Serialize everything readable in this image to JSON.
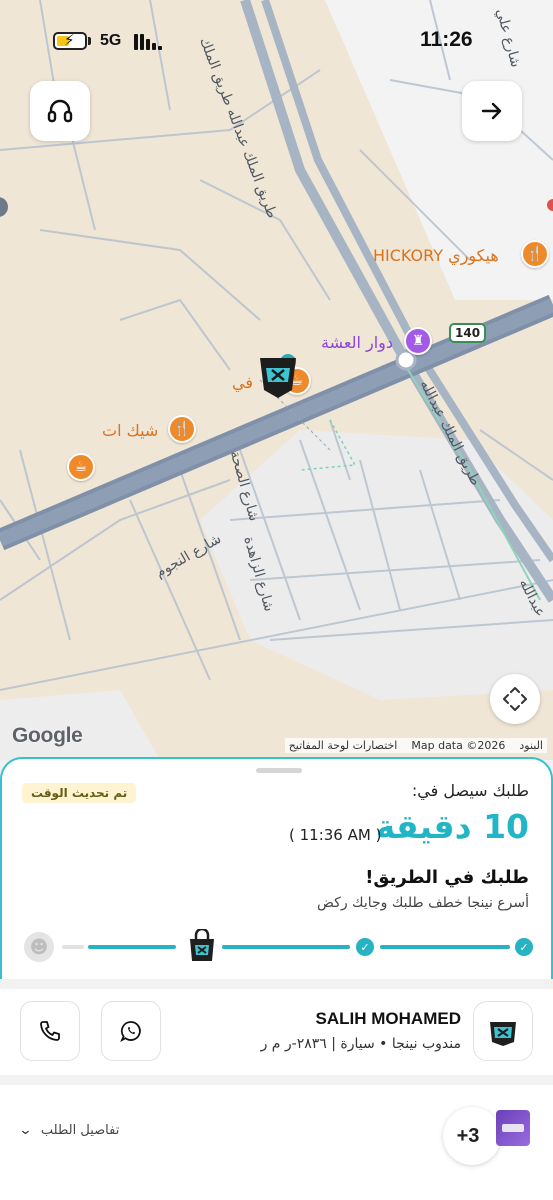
{
  "status_bar": {
    "network": "5G",
    "time": "11:26"
  },
  "map": {
    "road_labels": {
      "king_abdullah_1": "طريق الملك عبدالله طريق الملك",
      "king_abdullah_2": "طريق الملك عبدالله",
      "king_abdullah_3": "عبدالله",
      "ali_st": "شارع علي",
      "nujoom": "شارع النجوم",
      "sihha": "شارع الصحة",
      "zahida": "شارع الزاهدة"
    },
    "pois": {
      "hickory": "HICKORY هيكوري",
      "roundabout": "دوار العشة",
      "shake": "شيك ات",
      "cafe": "في"
    },
    "highway_shield": "140",
    "google": "Google",
    "attribution": {
      "keyboard": "اختصارات لوحة المفاتيح",
      "data": "Map data ©2026",
      "terms": "البنود"
    },
    "icons": {
      "support": "headset-icon",
      "forward": "arrow-right-icon",
      "recenter": "recenter-icon"
    }
  },
  "eta_card": {
    "updated_badge": "تم تحديث الوقت",
    "label": "طلبك سيصل في:",
    "eta": "10 دقيقة",
    "arrival_clock": "( 11:36 AM )",
    "status_title": "طلبك في الطريق!",
    "status_subtitle": "أسرع نينجا خطف طلبك وجايك ركض"
  },
  "rider": {
    "name": "SALIH MOHAMED",
    "info": "مندوب نينجا • سيارة | ٢٨٣٦-ر م ر"
  },
  "order": {
    "details_label": "تفاصيل الطلب",
    "extra_items": "+3"
  },
  "colors": {
    "accent": "#28b3c2",
    "map_bg": "#efe6d6",
    "highway": "#8797ad",
    "badge_bg": "#fff4d1"
  }
}
